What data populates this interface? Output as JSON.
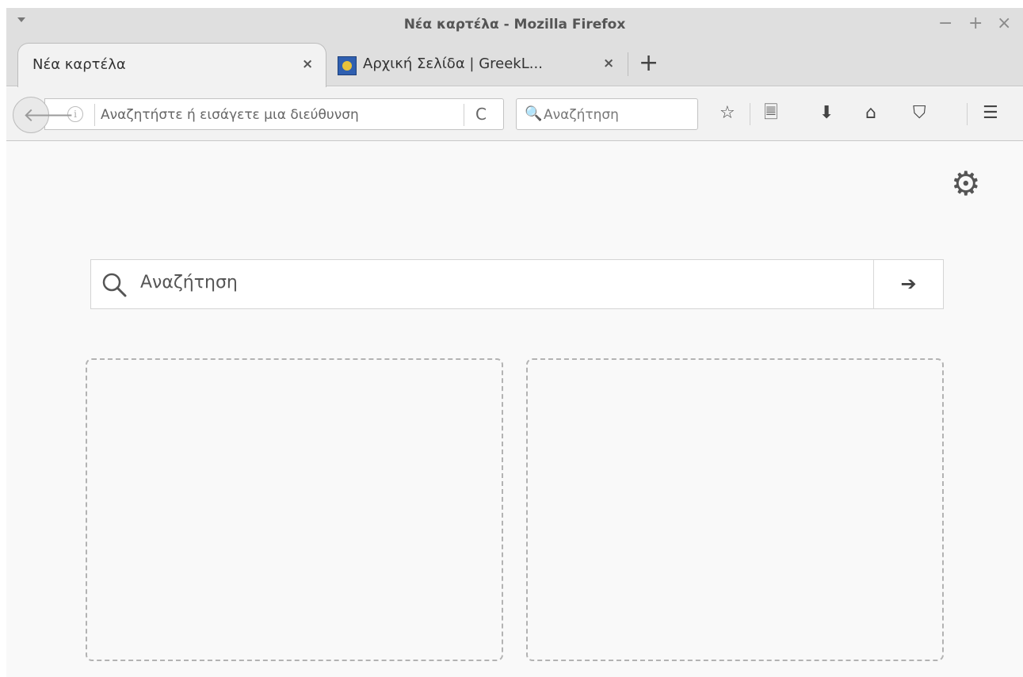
{
  "window": {
    "title": "Νέα καρτέλα - Mozilla Firefox",
    "controls": {
      "minimize": "−",
      "maximize": "+",
      "close": "×"
    }
  },
  "tabs": [
    {
      "label": "Νέα καρτέλα",
      "active": true,
      "close": "×"
    },
    {
      "label": "Αρχική Σελίδα | GreekL...",
      "active": false,
      "close": "×",
      "icon": "site-favicon"
    }
  ],
  "new_tab": "+",
  "navbar": {
    "back": "🡐",
    "info": "i",
    "url_placeholder": "Αναζητήστε ή εισάγετε μια διεύθυνση",
    "reload": "C",
    "search_icon": "🔍",
    "search_placeholder": "Αναζήτηση",
    "tools": [
      {
        "name": "bookmark-star-icon",
        "glyph": "☆"
      },
      {
        "name": "bookmarks-list-icon",
        "glyph": "🗏"
      },
      {
        "name": "downloads-icon",
        "glyph": "⬇"
      },
      {
        "name": "home-icon",
        "glyph": "⌂"
      },
      {
        "name": "pocket-icon",
        "glyph": "⛉"
      },
      {
        "name": "menu-icon",
        "glyph": "☰"
      }
    ]
  },
  "content": {
    "settings_glyph": "⚙",
    "search_placeholder": "Αναζήτηση",
    "search_go": "➔",
    "tiles": 2
  },
  "colors": {
    "chrome": "#dfdfdf",
    "page": "#f9f9f9",
    "tile_border": "#b3b3b3"
  }
}
